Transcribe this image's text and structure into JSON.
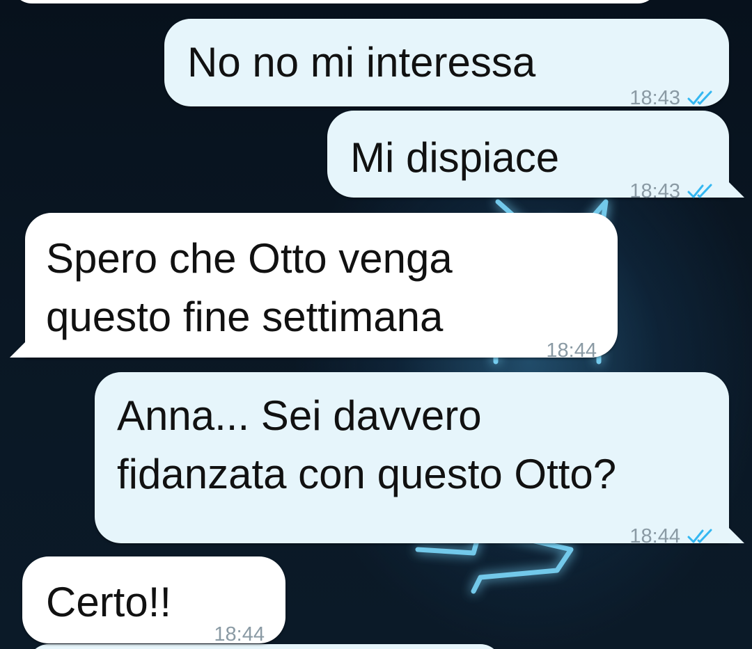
{
  "chat": {
    "messages": [
      {
        "direction": "outgoing",
        "text": "No no mi interessa",
        "time": "18:43",
        "status": "read"
      },
      {
        "direction": "outgoing",
        "text": "Mi dispiace",
        "time": "18:43",
        "status": "read"
      },
      {
        "direction": "incoming",
        "lines": [
          "Spero che Otto venga",
          "questo fine settimana"
        ],
        "time": "18:44"
      },
      {
        "direction": "outgoing",
        "lines": [
          "Anna... Sei davvero",
          "fidanzata con questo Otto?"
        ],
        "time": "18:44",
        "status": "read"
      },
      {
        "direction": "incoming",
        "text": "Certo!!",
        "time": "18:44"
      }
    ]
  },
  "theme": {
    "outgoing_bubble": "#e6f5fb",
    "incoming_bubble": "#ffffff",
    "read_tick_color": "#34b7f1",
    "background": "#07111c",
    "neon_glow": "#5fd0ff"
  },
  "icons": {
    "read_receipt": "double-check-icon"
  }
}
